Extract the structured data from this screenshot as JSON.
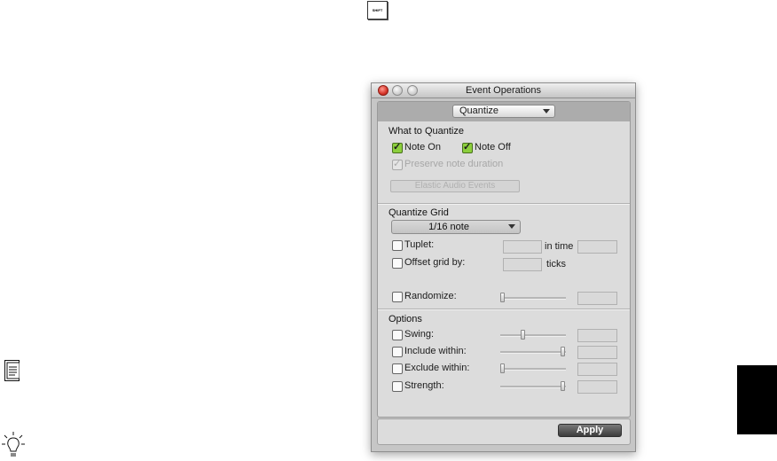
{
  "window": {
    "title": "Event Operations",
    "mode": "Quantize"
  },
  "shift_key": {
    "label": "SHIFT"
  },
  "what_to_quantize": {
    "title": "What to Quantize",
    "note_on": "Note On",
    "note_off": "Note Off",
    "preserve_note_duration": "Preserve note duration",
    "elastic_audio_events": "Elastic Audio Events"
  },
  "quantize_grid": {
    "title": "Quantize Grid",
    "grid_value": "1/16 note",
    "tuplet": "Tuplet:",
    "in_time": "in time",
    "offset_grid_by": "Offset grid by:",
    "ticks": "ticks",
    "randomize": "Randomize:"
  },
  "options": {
    "title": "Options",
    "swing": "Swing:",
    "include_within": "Include within:",
    "exclude_within": "Exclude within:",
    "strength": "Strength:",
    "slider_levels": {
      "randomize": 0.0,
      "swing": 0.35,
      "include_within": 1.0,
      "exclude_within": 0.0,
      "strength": 1.0
    }
  },
  "footer": {
    "apply": "Apply"
  },
  "icons": {
    "note": "note-icon",
    "tip": "lightbulb-icon"
  },
  "colors": {
    "checkbox_checked": "#8ccf3d",
    "close_button": "#d6352a",
    "side_tab": "#000000"
  }
}
